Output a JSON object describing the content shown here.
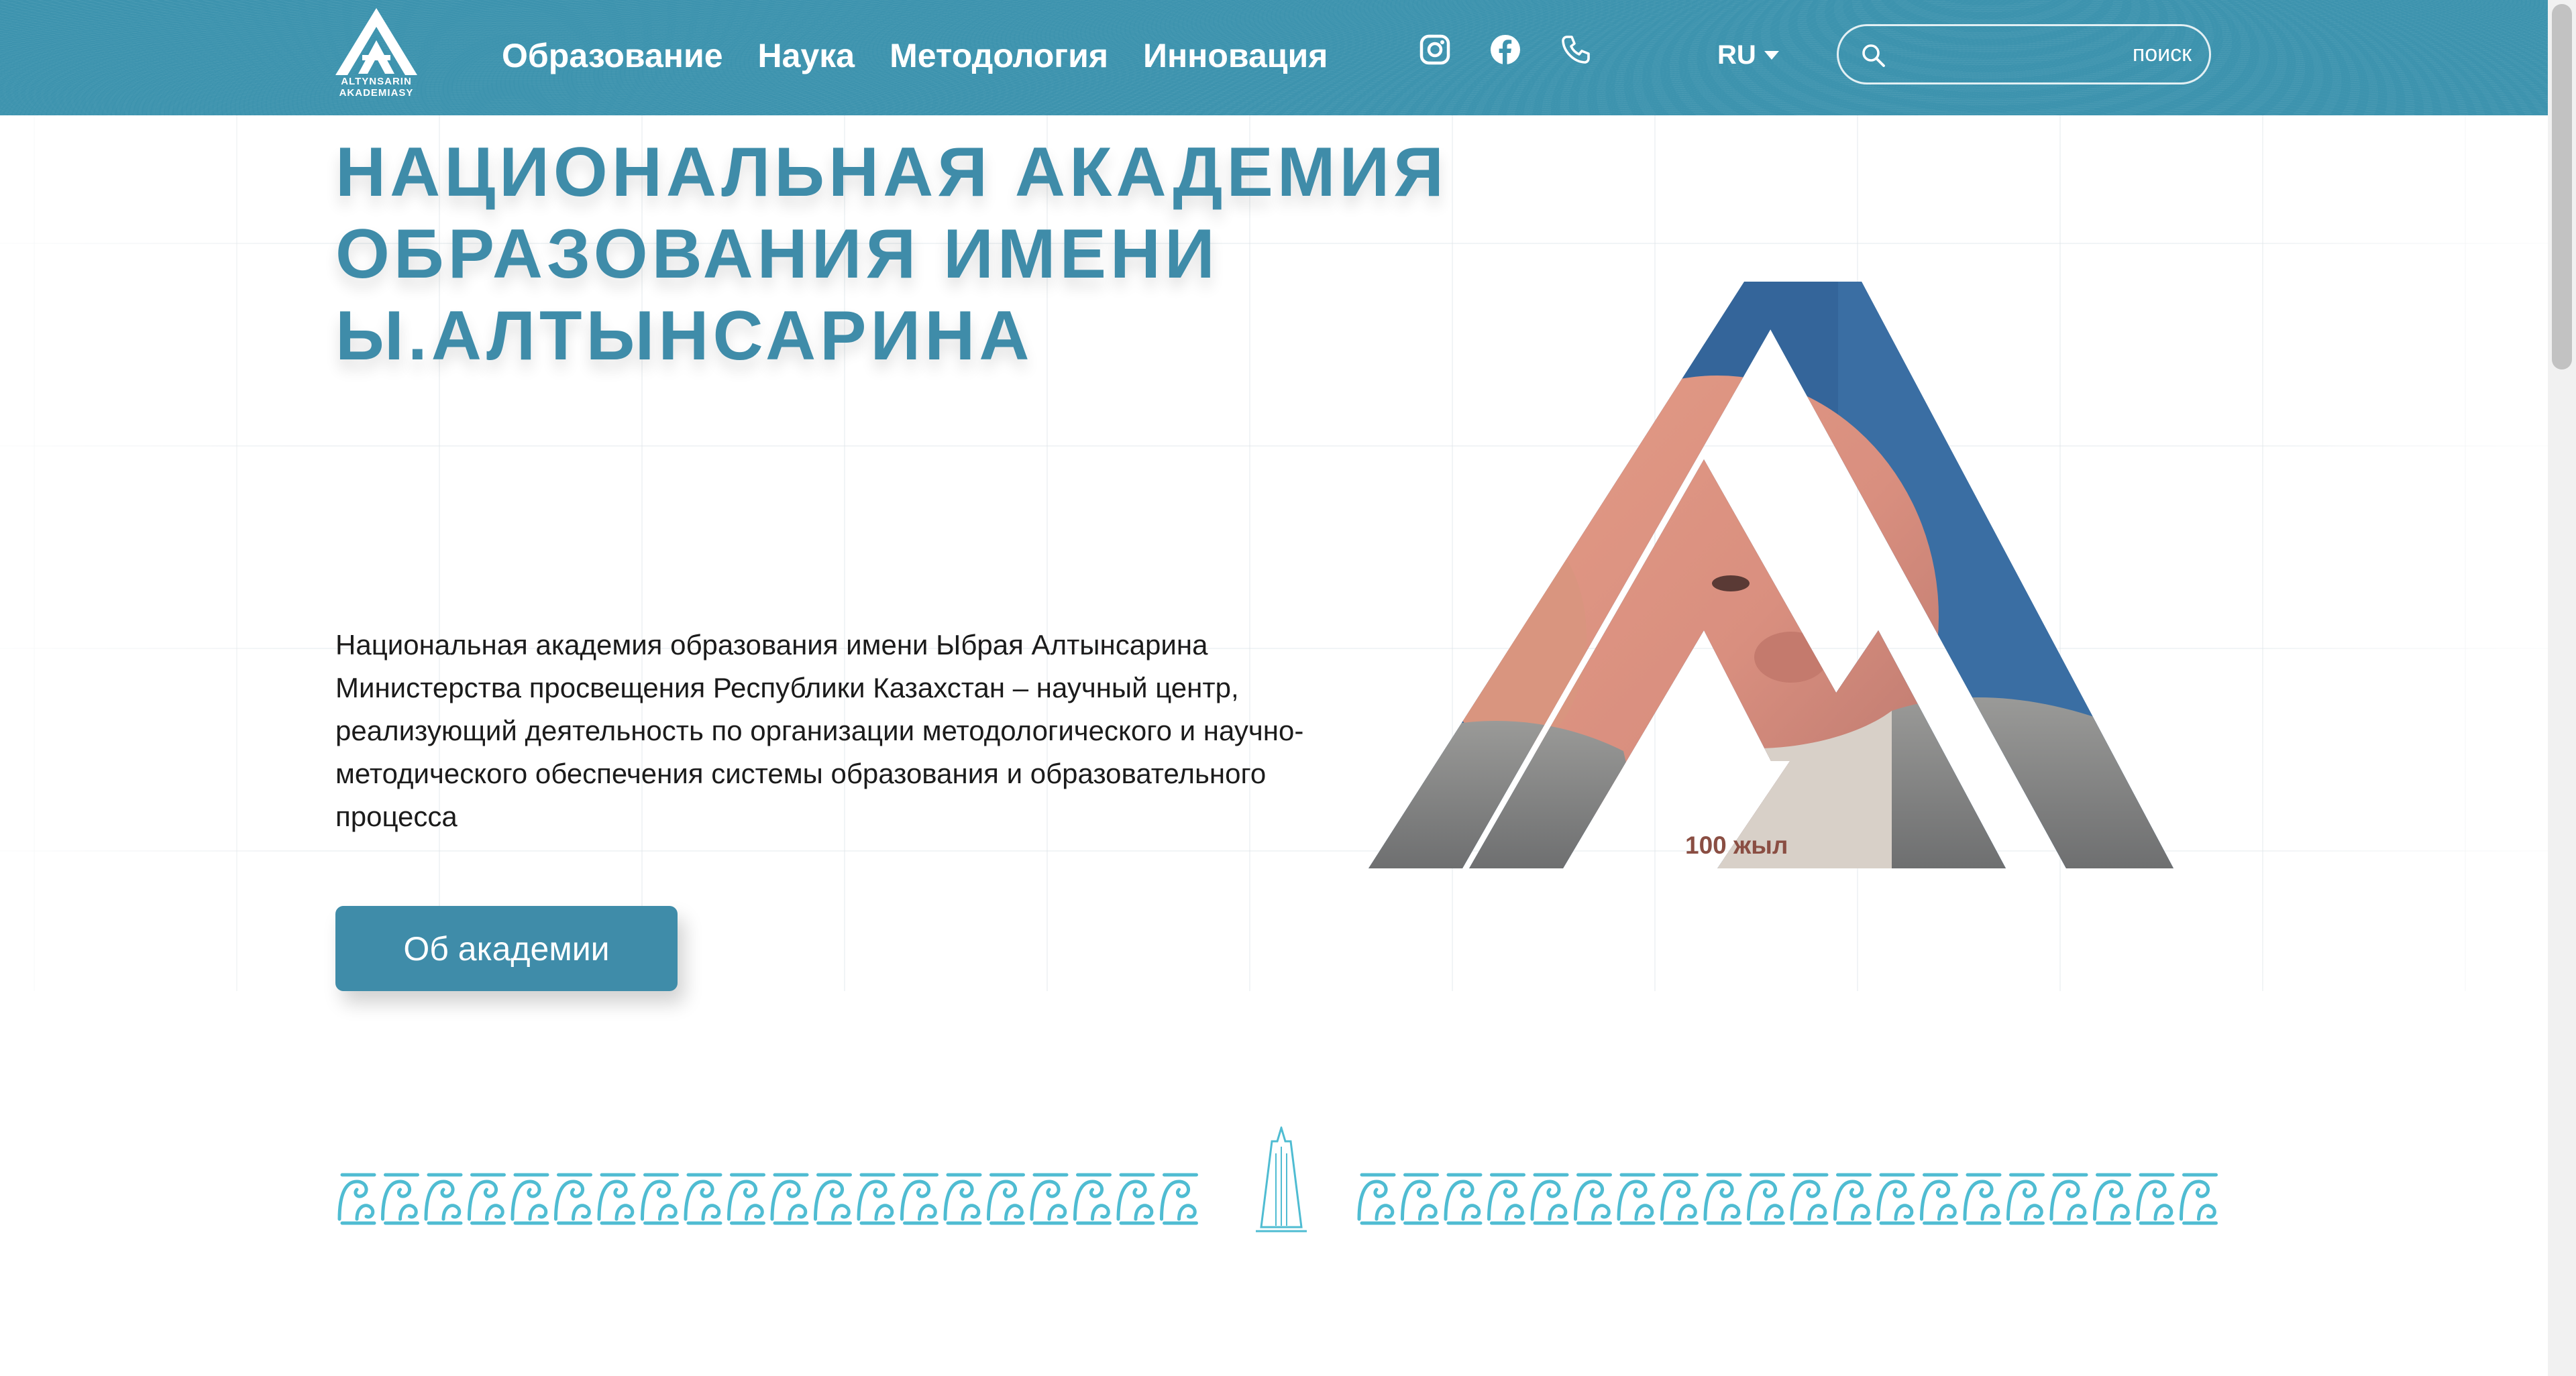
{
  "header": {
    "logo": {
      "name": "altynsarin-logo",
      "line1": "ALTYNSARIN",
      "line2": "AKADEMIASY"
    },
    "nav": [
      {
        "label": "Образование"
      },
      {
        "label": "Наука"
      },
      {
        "label": "Методология"
      },
      {
        "label": "Инновация"
      }
    ],
    "social": [
      {
        "icon": "instagram-icon"
      },
      {
        "icon": "facebook-icon"
      },
      {
        "icon": "phone-icon"
      }
    ],
    "language": {
      "value": "RU",
      "icon": "caret-down-icon"
    },
    "search": {
      "value": "",
      "placeholder": "",
      "button_label": "поиск",
      "icon": "search-icon"
    }
  },
  "hero": {
    "title": "НАЦИОНАЛЬНАЯ АКАДЕМИЯ ОБРАЗОВАНИЯ ИМЕНИ Ы.АЛТЫНСАРИНА",
    "description": "Национальная академия образования имени Ыбрая Алтынсарина Министерства просвещения Республики Казахстан – научный центр, реализующий деятельность по организации методологического и научно-методического обеспечения системы образования и образовательного процесса",
    "button_label": "Об академии",
    "emblem_caption": "100 жыл"
  },
  "colors": {
    "header_bg": "#3d93ae",
    "accent": "#3f8ca9",
    "ornament": "#4fbcd2"
  }
}
